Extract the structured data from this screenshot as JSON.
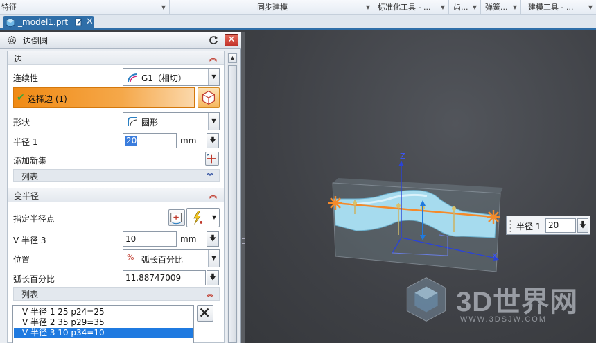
{
  "ribbon": {
    "groups": [
      {
        "label": "特征"
      },
      {
        "label": "同步建模"
      },
      {
        "label": "标准化工具 - ..."
      },
      {
        "label": "齿..."
      },
      {
        "label": "弹簧..."
      },
      {
        "label": "建模工具 - ..."
      }
    ]
  },
  "tab": {
    "label": "_model1.prt",
    "close": "✕"
  },
  "dialog": {
    "title": "边倒圆",
    "close": "✕",
    "edge_section": {
      "title": "边",
      "continuity_label": "连续性",
      "continuity_value": "G1（相切）",
      "select_edge_label": "选择边 (1)",
      "shape_label": "形状",
      "shape_value": "圆形",
      "radius1_label": "半径 1",
      "radius1_value": "20",
      "radius1_unit": "mm",
      "add_set_label": "添加新集",
      "list_label": "列表"
    },
    "variable_section": {
      "title": "变半径",
      "point_label": "指定半径点",
      "vradius_label": "V 半径 3",
      "vradius_value": "10",
      "vradius_unit": "mm",
      "position_label": "位置",
      "position_value": "弧长百分比",
      "arc_pct_label": "弧长百分比",
      "arc_pct_value": "11.88747009",
      "list_label": "列表",
      "list_items": [
        {
          "text": "V 半径 1  25  p24=25",
          "selected": false
        },
        {
          "text": "V 半径 2  35  p29=35",
          "selected": false
        },
        {
          "text": "V 半径 3  10  p34=10",
          "selected": true
        }
      ]
    }
  },
  "viewport": {
    "axis_z": "Z",
    "axis_x": "X",
    "radius_box": {
      "label": "半径 1",
      "value": "20"
    },
    "watermark": {
      "title": "3D世界网",
      "url": "WWW.3DSJW.COM"
    }
  },
  "colors": {
    "accent": "#2f6ea8",
    "selection_orange": "#f08a14",
    "edge_orange": "#f58a2a",
    "model_cyan": "#9fd6ea",
    "list_selected": "#1f7ae0"
  }
}
